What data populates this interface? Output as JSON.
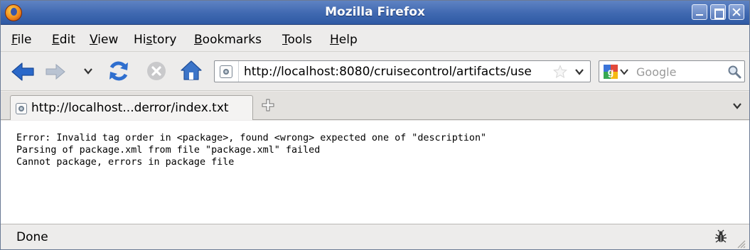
{
  "window": {
    "title": "Mozilla Firefox",
    "icon": "firefox-logo-icon",
    "controls": [
      "minimize-icon",
      "maximize-icon",
      "close-icon"
    ]
  },
  "menu": {
    "items": [
      {
        "pre": "",
        "key": "F",
        "post": "ile"
      },
      {
        "pre": "",
        "key": "E",
        "post": "dit"
      },
      {
        "pre": "",
        "key": "V",
        "post": "iew"
      },
      {
        "pre": "Hi",
        "key": "s",
        "post": "tory"
      },
      {
        "pre": "",
        "key": "B",
        "post": "ookmarks"
      },
      {
        "pre": "",
        "key": "T",
        "post": "ools"
      },
      {
        "pre": "",
        "key": "H",
        "post": "elp"
      }
    ]
  },
  "navigation": {
    "url": "http://localhost:8080/cruisecontrol/artifacts/use",
    "search_placeholder": "Google",
    "icons": [
      "back-icon",
      "forward-icon",
      "history-dropdown-icon",
      "reload-icon",
      "stop-icon",
      "home-icon",
      "bookmark-star-icon",
      "url-dropdown-icon",
      "search-engine-icon",
      "search-go-icon"
    ]
  },
  "tabs": {
    "items": [
      {
        "label": "http://localhost...derror/index.txt",
        "active": true
      }
    ]
  },
  "content": {
    "lines": [
      "Error: Invalid tag order in <package>, found <wrong> expected one of \"description\"",
      "Parsing of package.xml from file \"package.xml\" failed",
      "Cannot package, errors in package file"
    ]
  },
  "status": {
    "text": "Done"
  },
  "colors": {
    "titlebar": "#3f68b0",
    "back_arrow": "#2a68c9",
    "home": "#3b74c8",
    "chrome_bg": "#edeceb"
  }
}
